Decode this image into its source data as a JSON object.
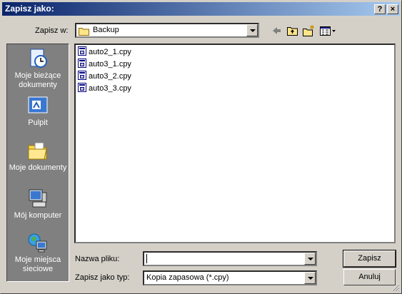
{
  "window": {
    "title": "Zapisz jako:",
    "help_label": "?",
    "close_label": "×"
  },
  "location": {
    "label": "Zapisz w:",
    "value": "Backup"
  },
  "places": [
    {
      "label": "Moje bieżące dokumenty",
      "icon": "recent-documents-icon"
    },
    {
      "label": "Pulpit",
      "icon": "desktop-icon"
    },
    {
      "label": "Moje dokumenty",
      "icon": "my-documents-icon"
    },
    {
      "label": "Mój komputer",
      "icon": "my-computer-icon"
    },
    {
      "label": "Moje miejsca sieciowe",
      "icon": "network-places-icon"
    }
  ],
  "files": [
    {
      "name": "auto2_1.cpy"
    },
    {
      "name": "auto3_1.cpy"
    },
    {
      "name": "auto3_2.cpy"
    },
    {
      "name": "auto3_3.cpy"
    }
  ],
  "filename": {
    "label": "Nazwa pliku:",
    "value": ""
  },
  "filetype": {
    "label": "Zapisz jako typ:",
    "value": "Kopia zapasowa (*.cpy)"
  },
  "buttons": {
    "save": "Zapisz",
    "cancel": "Anuluj"
  },
  "colors": {
    "titlebar_start": "#0a246a",
    "titlebar_end": "#a6caf0",
    "face": "#d4d0c8",
    "places_bg": "#808080"
  }
}
